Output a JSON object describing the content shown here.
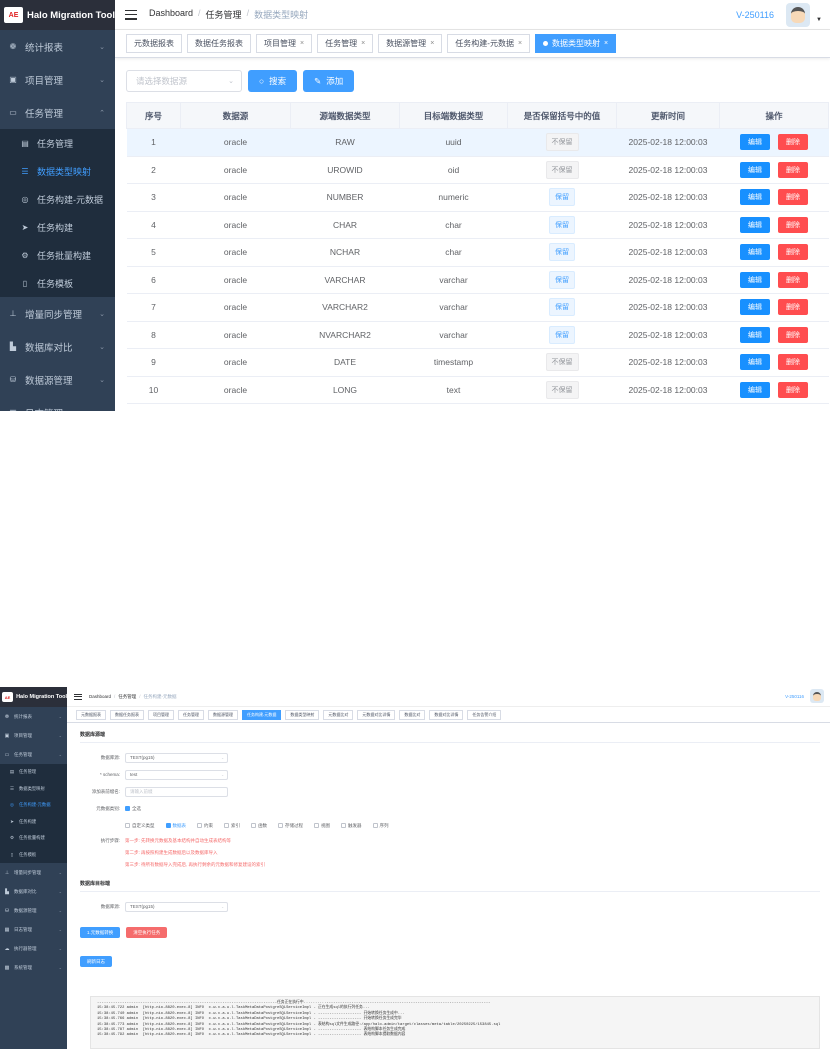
{
  "app": {
    "title": "Halo Migration Tool",
    "logo_text": "AE"
  },
  "shot1": {
    "sidebar": [
      {
        "label": "统计报表",
        "icon": "chart-icon",
        "type": "menu"
      },
      {
        "label": "项目管理",
        "icon": "folder-icon",
        "type": "menu"
      },
      {
        "label": "任务管理",
        "icon": "monitor-icon",
        "type": "menu",
        "expanded": true
      },
      {
        "label": "任务管理",
        "icon": "list-icon",
        "type": "sub"
      },
      {
        "label": "数据类型映射",
        "icon": "map-icon",
        "type": "sub",
        "active": true
      },
      {
        "label": "任务构建-元数据",
        "icon": "build-icon",
        "type": "sub"
      },
      {
        "label": "任务构建",
        "icon": "send-icon",
        "type": "sub"
      },
      {
        "label": "任务批量构建",
        "icon": "gear-icon",
        "type": "sub"
      },
      {
        "label": "任务模板",
        "icon": "doc-icon",
        "type": "sub"
      },
      {
        "label": "增量同步管理",
        "icon": "sitemap-icon",
        "type": "menu"
      },
      {
        "label": "数据库对比",
        "icon": "compare-icon",
        "type": "menu"
      },
      {
        "label": "数据源管理",
        "icon": "database-icon",
        "type": "menu"
      },
      {
        "label": "日志管理",
        "icon": "log-icon",
        "type": "menu"
      }
    ],
    "breadcrumb": [
      "Dashboard",
      "任务管理",
      "数据类型映射"
    ],
    "version": "V-250116",
    "tags": [
      {
        "label": "元数据报表",
        "closable": false
      },
      {
        "label": "数据任务报表",
        "closable": false
      },
      {
        "label": "项目管理",
        "closable": true
      },
      {
        "label": "任务管理",
        "closable": true
      },
      {
        "label": "数据源管理",
        "closable": true
      },
      {
        "label": "任务构建-元数据",
        "closable": true
      },
      {
        "label": "数据类型映射",
        "closable": true,
        "active": true
      }
    ],
    "filter": {
      "placeholder": "请选择数据源",
      "search_label": "搜索",
      "add_label": "添加"
    },
    "table": {
      "headers": [
        "序号",
        "数据源",
        "源端数据类型",
        "目标端数据类型",
        "是否保留括号中的值",
        "更新时间",
        "操作"
      ],
      "edit_label": "编辑",
      "delete_label": "删除",
      "keep_label": "保留",
      "nokeep_label": "不保留",
      "rows": [
        {
          "no": "1",
          "source": "oracle",
          "src_type": "RAW",
          "dst_type": "uuid",
          "keep": false,
          "updated": "2025-02-18 12:00:03"
        },
        {
          "no": "2",
          "source": "oracle",
          "src_type": "UROWID",
          "dst_type": "oid",
          "keep": false,
          "updated": "2025-02-18 12:00:03"
        },
        {
          "no": "3",
          "source": "oracle",
          "src_type": "NUMBER",
          "dst_type": "numeric",
          "keep": true,
          "updated": "2025-02-18 12:00:03"
        },
        {
          "no": "4",
          "source": "oracle",
          "src_type": "CHAR",
          "dst_type": "char",
          "keep": true,
          "updated": "2025-02-18 12:00:03"
        },
        {
          "no": "5",
          "source": "oracle",
          "src_type": "NCHAR",
          "dst_type": "char",
          "keep": true,
          "updated": "2025-02-18 12:00:03"
        },
        {
          "no": "6",
          "source": "oracle",
          "src_type": "VARCHAR",
          "dst_type": "varchar",
          "keep": true,
          "updated": "2025-02-18 12:00:03"
        },
        {
          "no": "7",
          "source": "oracle",
          "src_type": "VARCHAR2",
          "dst_type": "varchar",
          "keep": true,
          "updated": "2025-02-18 12:00:03"
        },
        {
          "no": "8",
          "source": "oracle",
          "src_type": "NVARCHAR2",
          "dst_type": "varchar",
          "keep": true,
          "updated": "2025-02-18 12:00:03"
        },
        {
          "no": "9",
          "source": "oracle",
          "src_type": "DATE",
          "dst_type": "timestamp",
          "keep": false,
          "updated": "2025-02-18 12:00:03"
        },
        {
          "no": "10",
          "source": "oracle",
          "src_type": "LONG",
          "dst_type": "text",
          "keep": false,
          "updated": "2025-02-18 12:00:03"
        }
      ]
    }
  },
  "shot2": {
    "sidebar": [
      {
        "label": "统计报表",
        "icon": "chart-icon",
        "type": "menu"
      },
      {
        "label": "项目管理",
        "icon": "folder-icon",
        "type": "menu"
      },
      {
        "label": "任务管理",
        "icon": "monitor-icon",
        "type": "menu"
      },
      {
        "label": "任务管理",
        "icon": "list-icon",
        "type": "sub"
      },
      {
        "label": "数据类型映射",
        "icon": "map-icon",
        "type": "sub"
      },
      {
        "label": "任务构建-元数据",
        "icon": "build-icon",
        "type": "sub",
        "active": true
      },
      {
        "label": "任务构建",
        "icon": "send-icon",
        "type": "sub"
      },
      {
        "label": "任务批量构建",
        "icon": "gear-icon",
        "type": "sub"
      },
      {
        "label": "任务模板",
        "icon": "doc-icon",
        "type": "sub"
      },
      {
        "label": "增量同步管理",
        "icon": "sitemap-icon",
        "type": "menu"
      },
      {
        "label": "数据库对比",
        "icon": "compare-icon",
        "type": "menu"
      },
      {
        "label": "数据源管理",
        "icon": "database-icon",
        "type": "menu"
      },
      {
        "label": "日志管理",
        "icon": "log-icon",
        "type": "menu"
      },
      {
        "label": "执行器管理",
        "icon": "cloud-icon",
        "type": "menu"
      },
      {
        "label": "系统管理",
        "icon": "system-icon",
        "type": "menu"
      }
    ],
    "breadcrumb": [
      "Dashboard",
      "任务管理",
      "任务构建-元数据"
    ],
    "version": "V-250116",
    "tags": [
      "元数据报表",
      "数据任务报表",
      "项目管理",
      "任务管理",
      "数据源管理",
      "任务构建-元数据",
      "数据类型映射",
      "元数据比对",
      "元数据对比详情",
      "数据比对",
      "数据对比详情",
      "任务告警介绍"
    ],
    "active_tag": 5,
    "source_section": "数据库源端",
    "target_section": "数据库目标端",
    "fields": {
      "datasource_label": "数据库源:",
      "datasource_value": "TEST(pg15)",
      "schema_label": "* schema:",
      "schema_value": "test",
      "table_label": "添加表前缀名:",
      "table_placeholder": "请输入前缀",
      "meta_label": "元数据类别:",
      "meta_all": "全选",
      "target_label": "数据库源:",
      "target_value": "TEST(pg15)"
    },
    "meta_options": [
      {
        "label": "自定义类型",
        "checked": false
      },
      {
        "label": "数据表",
        "checked": true
      },
      {
        "label": "约束",
        "checked": false
      },
      {
        "label": "索引",
        "checked": false
      },
      {
        "label": "函数",
        "checked": false
      },
      {
        "label": "存储过程",
        "checked": false
      },
      {
        "label": "视图",
        "checked": false
      },
      {
        "label": "触发器",
        "checked": false
      },
      {
        "label": "序列",
        "checked": false
      }
    ],
    "exec_label": "执行步骤:",
    "steps": [
      "第一步: 先转换元数据及基本结构并自动生成表结构等",
      "第二步: 再按照构建生成数据后以及数据库导入",
      "第三步: 待所有数据导入完成后, 再执行剩余的元数据和修复建设的索引"
    ],
    "buttons": {
      "build": "1.元数据转换",
      "clear": "清空执行任务",
      "log": "刷新日志"
    },
    "log_lines": [
      "-------------------------------------------------------------------------------任务正在执行中..........------------------------------------------------------------------------",
      "15:38:45.722 admin  [http-nio-8820-exec-8] INFO  c.w.x.a.u.l.TaskMetaDataPostgreSQLServiceImpl - 正在生成sql的执行列任务...",
      "15:38:45.740 admin  [http-nio-8820-exec-8] INFO  c.w.x.a.u.l.TaskMetaDataPostgreSQLServiceImpl - ------------------- 开始转换任务生成中...",
      "15:38:45.766 admin  [http-nio-8820-exec-8] INFO  c.w.x.a.u.l.TaskMetaDataPostgreSQLServiceImpl - ------------------- 开始转换任务生成完毕",
      "15:38:45.773 admin  [http-nio-8820-exec-8] INFO  c.w.x.a.u.l.TaskMetaDataPostgreSQLServiceImpl - 表结构sql文件生成路径:/app/halo-admin/target/classes/meta/table/20250225/153845.sql",
      "15:38:45.787 admin  [http-nio-8820-exec-8] INFO  c.w.x.a.u.l.TaskMetaDataPostgreSQLServiceImpl - ------------------- 表结构脚本任务生成完成",
      "15:38:45.792 admin  [http-nio-8820-exec-8] INFO  c.w.x.a.u.l.TaskMetaDataPostgreSQLServiceImpl - ------------------- 表结构脚本提取数据内容"
    ]
  }
}
